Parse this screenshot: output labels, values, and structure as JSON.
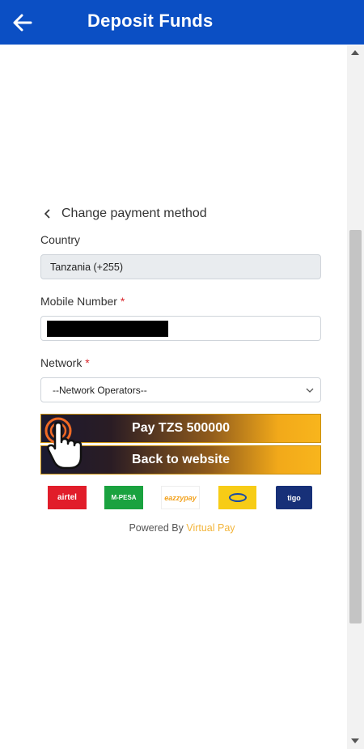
{
  "appbar": {
    "title": "Deposit Funds",
    "back_icon": "arrow-left-icon",
    "color": "#0b4fc4"
  },
  "form": {
    "change_method_label": "Change payment method",
    "country_label": "Country",
    "country_value": "Tanzania (+255)",
    "mobile_label": "Mobile Number",
    "mobile_required": "*",
    "network_label": "Network",
    "network_required": "*",
    "network_selected": "--Network Operators--"
  },
  "buttons": {
    "pay_label": "Pay TZS 500000",
    "back_label": "Back to website"
  },
  "logos": {
    "airtel": "airtel",
    "mpesa": "M-PESA",
    "ezy_a": "eazzy",
    "ezy_b": "pay",
    "tigo": "tigo"
  },
  "footer": {
    "powered_prefix": "Powered By",
    "powered_brand": "Virtual Pay"
  },
  "colors": {
    "accent": "#f8b51c",
    "required": "#d9262c",
    "brand": "#0b4fc4"
  }
}
